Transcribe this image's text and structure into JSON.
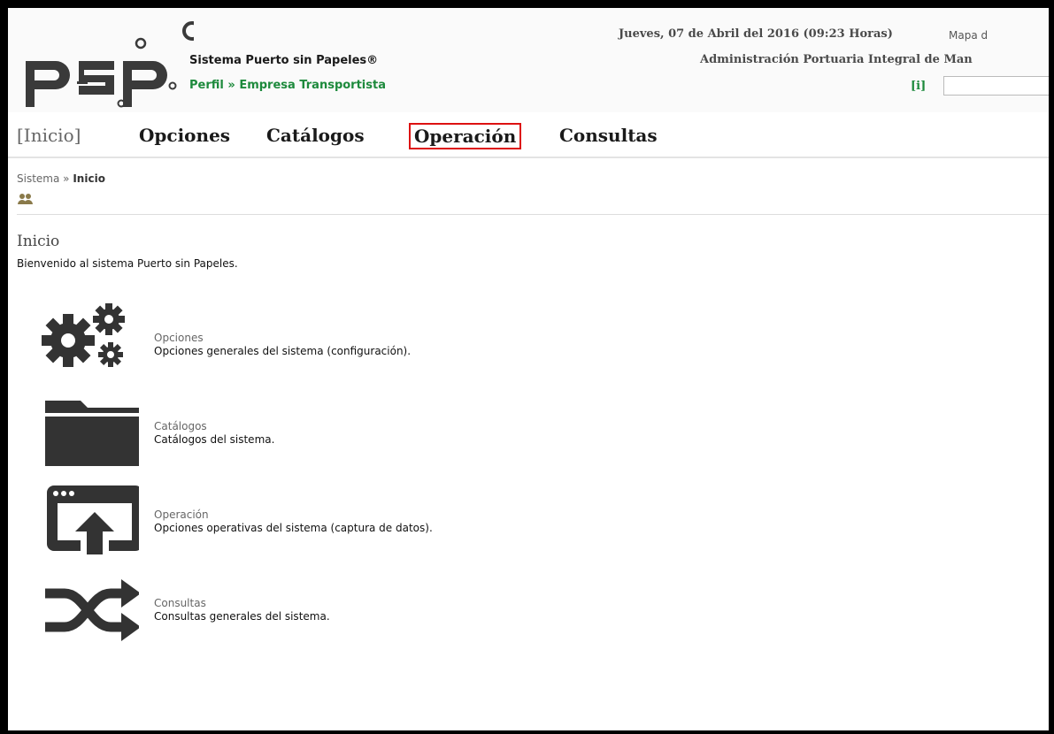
{
  "header": {
    "system_name": "Sistema Puerto sin Papeles®",
    "profile_label": "Perfil",
    "profile_separator": "»",
    "profile_value": "Empresa Transportista",
    "date": "Jueves, 07 de Abril del 2016 (09:23 Horas)",
    "site_map": "Mapa d",
    "organization": "Administración Portuaria Integral de Man",
    "info_link": "[i]",
    "search_value": ""
  },
  "nav": {
    "home": "[Inicio]",
    "options": "Opciones",
    "catalogs": "Catálogos",
    "operation": "Operación",
    "queries": "Consultas"
  },
  "breadcrumb": {
    "root": "Sistema",
    "separator": "»",
    "current": "Inicio"
  },
  "main": {
    "title": "Inicio",
    "welcome": "Bienvenido al sistema Puerto sin Papeles.",
    "items": [
      {
        "title": "Opciones",
        "description": "Opciones generales del sistema (configuración).",
        "icon": "gears-icon"
      },
      {
        "title": "Catálogos",
        "description": "Catálogos del sistema.",
        "icon": "folder-icon"
      },
      {
        "title": "Operación",
        "description": "Opciones operativas del sistema (captura de datos).",
        "icon": "window-upload-icon"
      },
      {
        "title": "Consultas",
        "description": "Consultas generales del sistema.",
        "icon": "shuffle-icon"
      }
    ]
  },
  "colors": {
    "accent_green": "#1d8a3c",
    "active_outline": "#dd1111",
    "icon_dark": "#333333"
  }
}
